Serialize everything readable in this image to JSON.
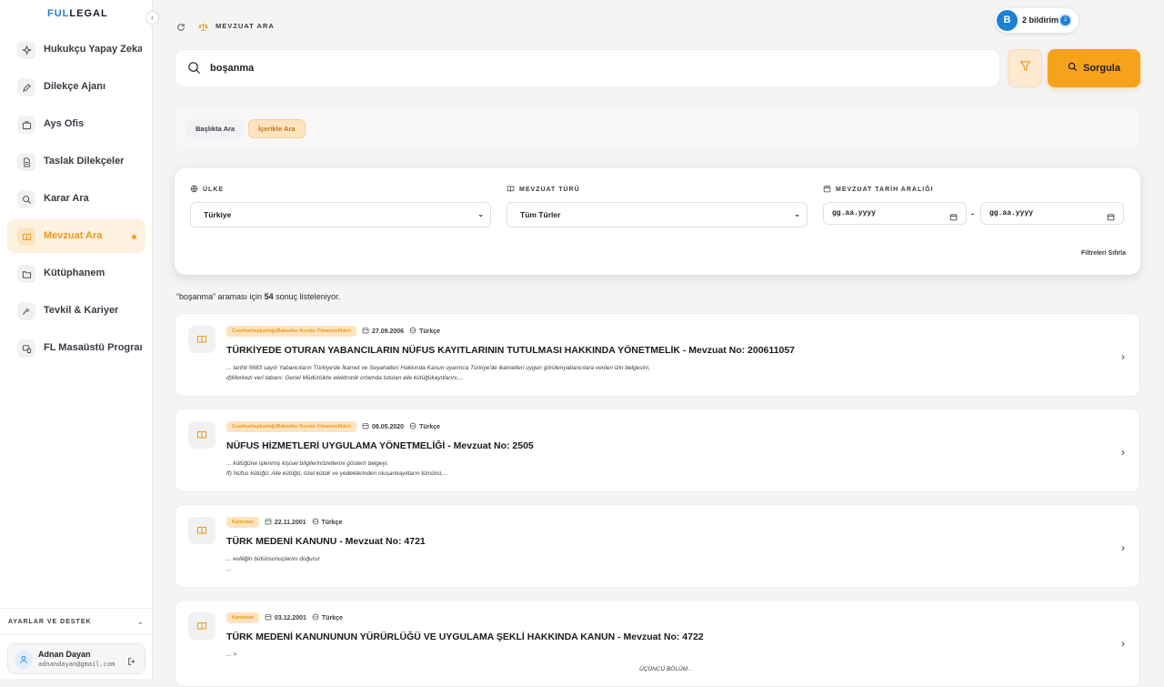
{
  "brand": {
    "part1": "FUL",
    "part2": "LEGAL"
  },
  "sidebar": {
    "items": [
      {
        "label": "Hukukçu Yapay Zeka",
        "icon": "sparkle-icon"
      },
      {
        "label": "Dilekçe Ajanı",
        "icon": "pen-icon"
      },
      {
        "label": "Ays Ofis",
        "icon": "briefcase-icon"
      },
      {
        "label": "Taslak Dilekçeler",
        "icon": "document-icon"
      },
      {
        "label": "Karar Ara",
        "icon": "search-icon"
      },
      {
        "label": "Mevzuat Ara",
        "icon": "book-icon",
        "active": true
      },
      {
        "label": "Kütüphanem",
        "icon": "folder-icon"
      },
      {
        "label": "Tevkil & Kariyer",
        "icon": "gavel-icon"
      },
      {
        "label": "FL Masaüstü Programı",
        "icon": "desktop-icon"
      }
    ],
    "settings_label": "AYARLAR VE DESTEK",
    "user": {
      "name": "Adnan Dayan",
      "email": "adnandayan@gmail.com"
    }
  },
  "header": {
    "breadcrumb": "MEVZUAT ARA",
    "notification_text": "2 bildirim",
    "avatar_letter": "B",
    "notification_count": "2"
  },
  "search": {
    "value": "boşanma",
    "query_button": "Sorgula"
  },
  "modes": {
    "title_search": "Başlıkta Ara",
    "content_search": "İçerikte Ara"
  },
  "filters": {
    "country_label": "ÜLKE",
    "country_value": "Türkiye",
    "type_label": "MEVZUAT TÜRÜ",
    "type_value": "Tüm Türler",
    "date_label": "MEVZUAT TARİH ARALIĞI",
    "date_from": "gg.aa.yyyy",
    "date_to": "gg.aa.yyyy",
    "reset": "Filtreleri Sıfırla"
  },
  "results": {
    "query_quoted": "“boşanma” araması için",
    "count": "54",
    "suffix": "sonuç listeleniyor."
  },
  "cards": [
    {
      "category": "Cumhurbaşkanlığı/Bakanlar Kurulu Yönetmelikleri",
      "date": "27.09.2006",
      "lang": "Türkçe",
      "title": "TÜRKİYEDE OTURAN YABANCILARIN NÜFUS KAYITLARININ TUTULMASI HAKKINDA YÖNETMELİK - Mevzuat No: 200611057",
      "line1": "... tarihli 5683 sayılı Yabancıların Türkiye'de İkamet ve Seyahatleri Hakkında Kanun uyarınca Türkiye'de ikametleri uygun görülenyabancılara verilen izin belgesini,",
      "line2": "d)Merkezi veri tabanı: Genel Müdürlükte elektronik ortamda tutulan aile kütüğükayıtlarını,..."
    },
    {
      "category": "Cumhurbaşkanlığı/Bakanlar Kurulu Yönetmelikleri",
      "date": "08.05.2020",
      "lang": "Türkçe",
      "title": "NÜFUS HİZMETLERİ UYGULAMA YÖNETMELİĞİ - Mevzuat No: 2505",
      "line1": "... kütüğüne işlenmiş kişisel bilgilerinözetlerini gösterir belgeyi,",
      "line2": "ff) Nüfus kütüğü: Aile kütüğü, özel kütük ve yedeklerinden oluşankayıtların tümünü,..."
    },
    {
      "category": "Kanunlar",
      "date": "22.11.2001",
      "lang": "Türkçe",
      "title": "TÜRK MEDENİ KANUNU - Mevzuat No: 4721",
      "line1": "... evliliğin bütünsonuçlarını doğurur.",
      "line2": "..."
    },
    {
      "category": "Kanunlar",
      "date": "03.12.2001",
      "lang": "Türkçe",
      "title": "TÜRK MEDENİ KANUNUNUN YÜRÜRLÜĞÜ VE UYGULAMA ŞEKLİ HAKKINDA KANUN - Mevzuat No: 4722",
      "line1": "... >",
      "line2": "ÜÇÜNCÜ BÖLÜM..."
    }
  ]
}
